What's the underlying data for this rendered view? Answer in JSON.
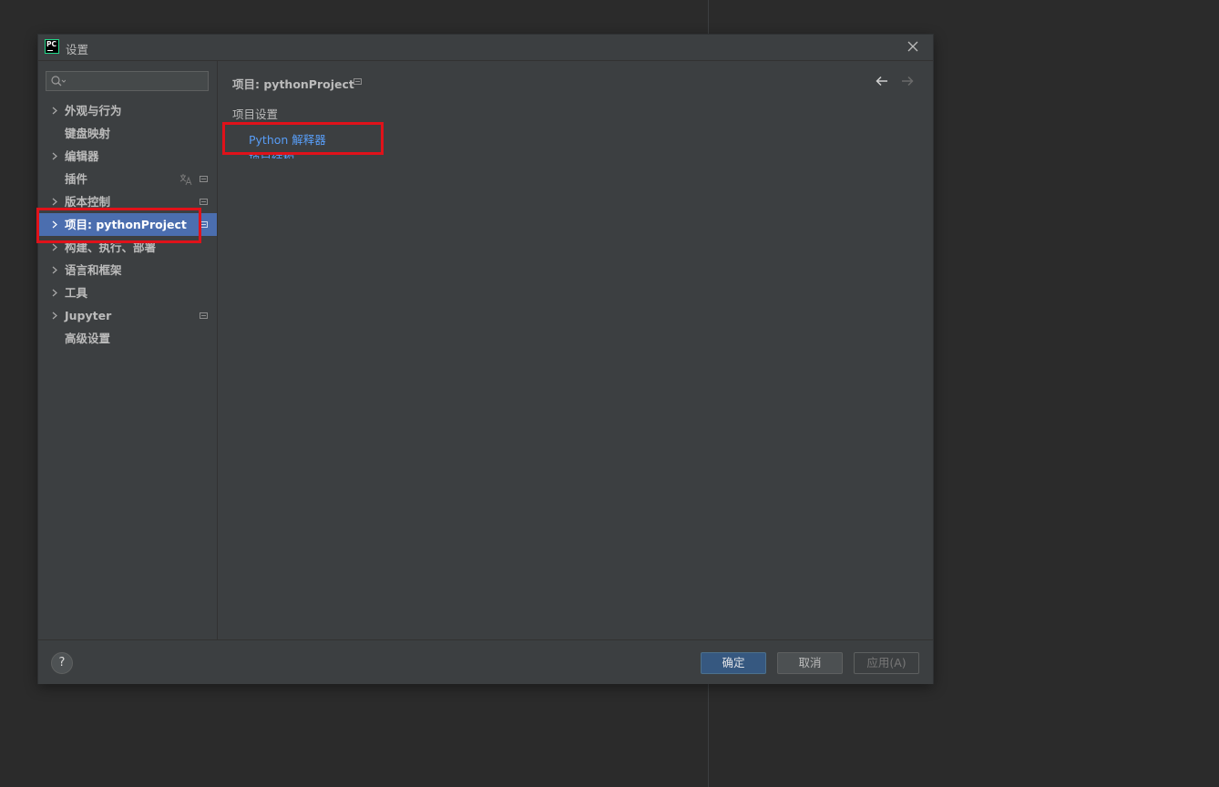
{
  "window": {
    "title": "设置",
    "app_icon_text": "PC"
  },
  "sidebar": {
    "search": {
      "value": "",
      "placeholder": ""
    },
    "items": [
      {
        "label": "外观与行为",
        "expandable": true,
        "selected": false
      },
      {
        "label": "键盘映射",
        "expandable": false,
        "selected": false
      },
      {
        "label": "编辑器",
        "expandable": true,
        "selected": false
      },
      {
        "label": "插件",
        "expandable": false,
        "selected": false
      },
      {
        "label": "版本控制",
        "expandable": true,
        "selected": false
      },
      {
        "label": "项目: pythonProject",
        "expandable": true,
        "selected": true
      },
      {
        "label": "构建、执行、部署",
        "expandable": true,
        "selected": false
      },
      {
        "label": "语言和框架",
        "expandable": true,
        "selected": false
      },
      {
        "label": "工具",
        "expandable": true,
        "selected": false
      },
      {
        "label": "Jupyter",
        "expandable": true,
        "selected": false
      },
      {
        "label": "高级设置",
        "expandable": false,
        "selected": false
      }
    ]
  },
  "main": {
    "breadcrumb": "项目: pythonProject",
    "section_title": "项目设置",
    "links": [
      {
        "label": "Python 解释器"
      },
      {
        "label": "项目结构"
      }
    ]
  },
  "footer": {
    "help_label": "?",
    "ok_label": "确定",
    "cancel_label": "取消",
    "apply_label": "应用(A)"
  },
  "colors": {
    "background": "#2b2b2b",
    "dialog": "#3c3f41",
    "selection": "#4b6eaf",
    "link": "#589df6",
    "primary_button": "#365880",
    "highlight_box": "#e0121a"
  }
}
